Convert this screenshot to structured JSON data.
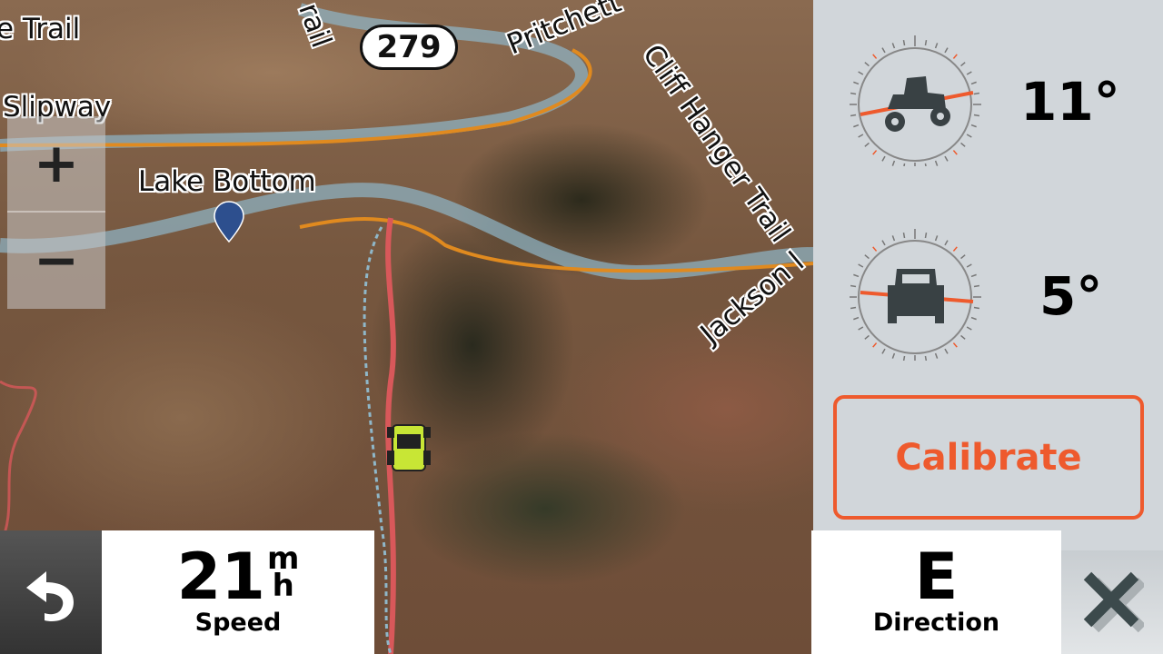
{
  "map": {
    "labels": {
      "trail_left": "e Trail",
      "trail_top": "rail",
      "pritchett": "Pritchett",
      "cliff_hanger": "Cliff Hanger Trail",
      "slipway": "Slipway",
      "lake_bottom": "Lake Bottom",
      "jackson": "Jackson l"
    },
    "route_shield": "279",
    "zoom_in": "+",
    "zoom_out": "−"
  },
  "inclinometer": {
    "pitch": "11°",
    "roll": "5°",
    "accent": "#ee5a2d"
  },
  "calibrate_label": "Calibrate",
  "speed": {
    "value": "21",
    "unit_top": "m",
    "unit_bottom": "h",
    "label": "Speed"
  },
  "direction": {
    "value": "E",
    "label": "Direction"
  }
}
